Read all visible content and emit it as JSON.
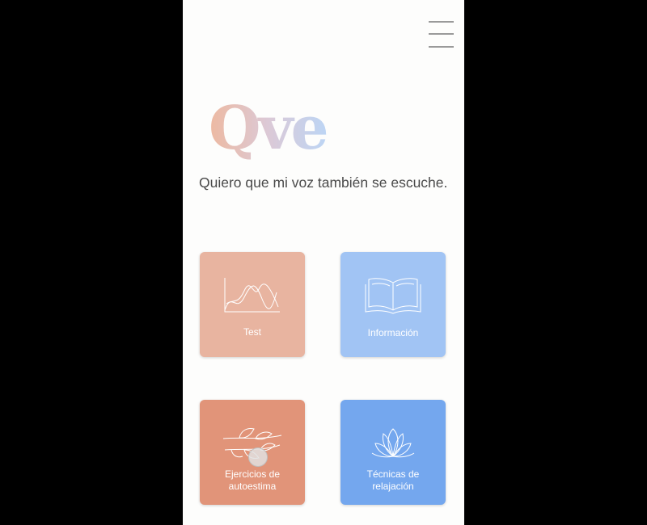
{
  "app": {
    "logo_text": "Qve",
    "tagline": "Quiero que mi voz también se escuche."
  },
  "header": {
    "menu_icon": "hamburger-menu-icon"
  },
  "cards": [
    {
      "label": "Test",
      "icon": "chart-icon",
      "color": "#e8b4a0"
    },
    {
      "label": "Información",
      "icon": "open-book-icon",
      "color": "#a1c4f4"
    },
    {
      "label": "Ejercicios de\nautoestima",
      "icon": "leaf-branch-icon",
      "color": "#e19479"
    },
    {
      "label": "Técnicas de\nrelajación",
      "icon": "lotus-icon",
      "color": "#74a7ee"
    }
  ],
  "colors": {
    "background": "#fdfdfc",
    "text": "#4a4a4a",
    "logo_gradient_start": "#edb9a1",
    "logo_gradient_end": "#bdd5f4"
  }
}
